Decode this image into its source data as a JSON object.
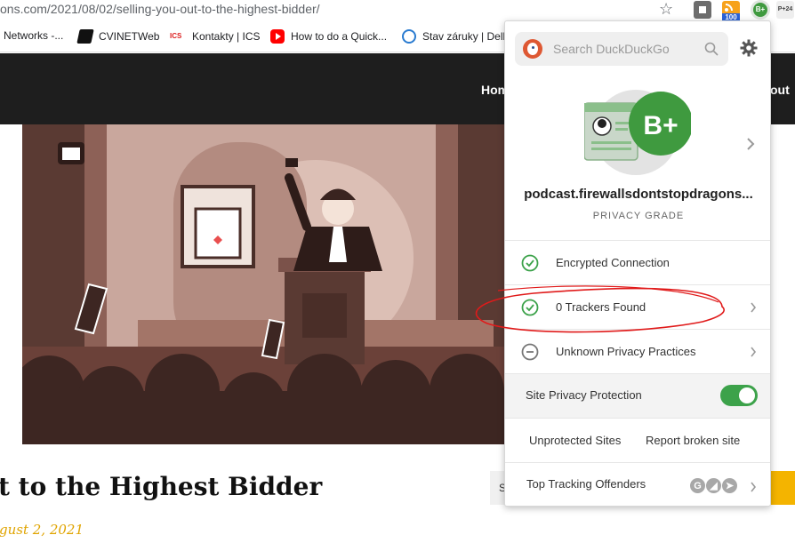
{
  "browser": {
    "url_host": "ons.com",
    "url_path": "/2021/08/02/selling-you-out-to-the-highest-bidder/",
    "extensions": {
      "ext2_badge": "100",
      "ext3_label": "B+",
      "ext4_label": "P+24"
    },
    "bookmarks": [
      {
        "label": "Networks -..."
      },
      {
        "label": "CVINETWeb"
      },
      {
        "label": "Kontakty | ICS",
        "icon_text": "ICS"
      },
      {
        "label": "How to do a Quick..."
      },
      {
        "label": "Stav záruky | Dell"
      }
    ]
  },
  "site": {
    "nav_home": "Hom",
    "nav_about": "out",
    "post_title": "t to the Highest Bidder",
    "post_date": "gust 2, 2021",
    "sidebar_search": "S"
  },
  "popup": {
    "search_placeholder": "Search DuckDuckGo",
    "grade": "B+",
    "domain": "podcast.firewallsdontstopdragons...",
    "grade_label": "PRIVACY GRADE",
    "rows": [
      {
        "label": "Encrypted Connection",
        "status": "check"
      },
      {
        "label": "0 Trackers Found",
        "status": "check"
      },
      {
        "label": "Unknown Privacy Practices",
        "status": "minus"
      }
    ],
    "protection_label": "Site Privacy Protection",
    "protection_enabled": true,
    "link_unprotected": "Unprotected Sites",
    "link_report": "Report broken site",
    "top_offenders_label": "Top Tracking Offenders",
    "offender_icons": [
      "G",
      "◢",
      "➤"
    ]
  },
  "colors": {
    "check_green": "#3ca24a",
    "grade_green": "#3f9a3f",
    "annotation_red": "#e01a1a",
    "ddg_orange": "#de5833"
  }
}
